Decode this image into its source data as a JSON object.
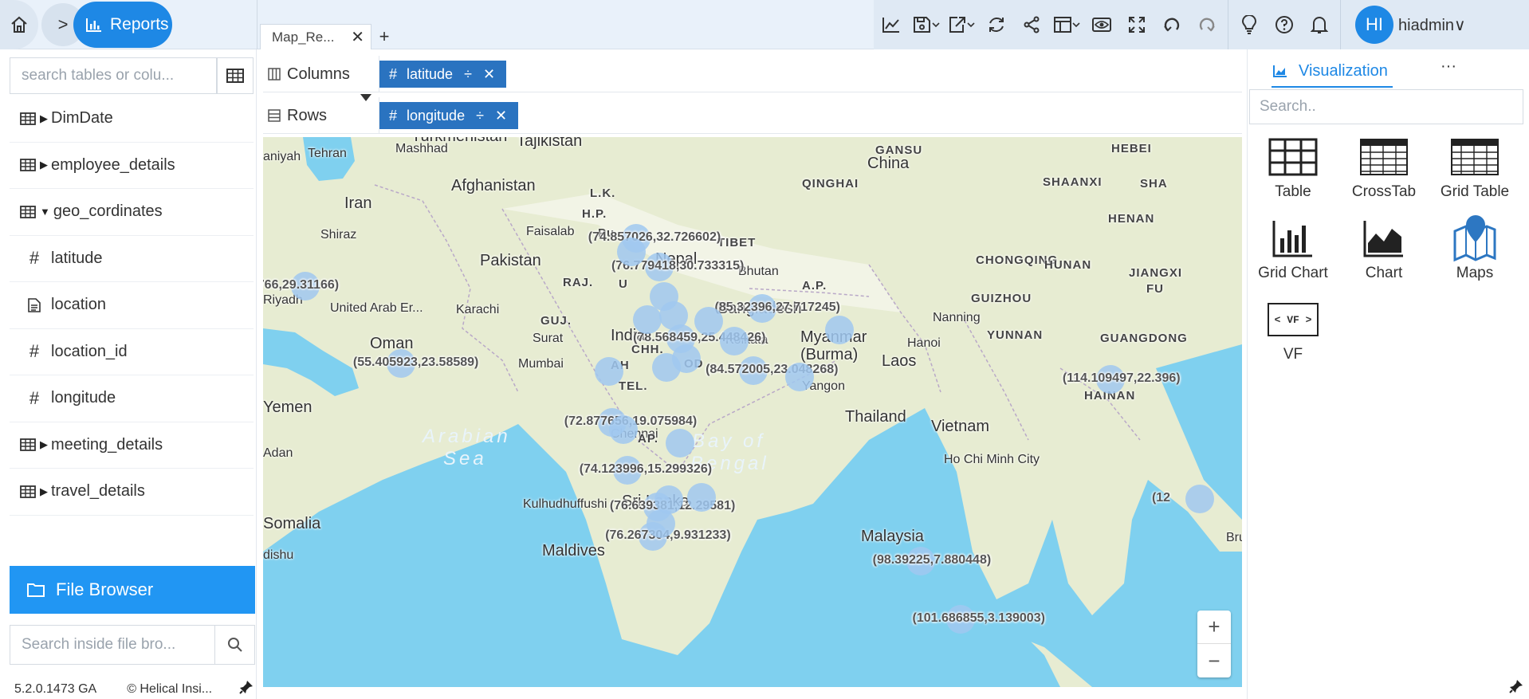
{
  "nav": {
    "app_label": "Reports"
  },
  "tabs": [
    {
      "label": "Map_Re...",
      "close": "✕"
    }
  ],
  "tab_add": "+",
  "user": {
    "initials": "HI",
    "name": "hiadmin"
  },
  "left_panel": {
    "search_placeholder": "search tables or colu...",
    "tree": [
      {
        "label": "DimDate",
        "type": "table",
        "expanded": false
      },
      {
        "label": "employee_details",
        "type": "table",
        "expanded": false
      },
      {
        "label": "geo_cordinates",
        "type": "table",
        "expanded": true
      },
      {
        "label": "latitude",
        "type": "numeric",
        "child": true
      },
      {
        "label": "location",
        "type": "text",
        "child": true
      },
      {
        "label": "location_id",
        "type": "numeric",
        "child": true
      },
      {
        "label": "longitude",
        "type": "numeric",
        "child": true
      },
      {
        "label": "meeting_details",
        "type": "table",
        "expanded": false
      },
      {
        "label": "travel_details",
        "type": "table",
        "expanded": false
      }
    ],
    "file_browser_label": "File Browser",
    "file_search_placeholder": "Search inside file bro...",
    "version": "5.2.0.1473 GA",
    "copyright": "© Helical Insi..."
  },
  "shelves": {
    "columns": {
      "label": "Columns",
      "field": "latitude"
    },
    "rows": {
      "label": "Rows",
      "field": "longitude"
    },
    "field_prefix": "#",
    "field_split": "÷",
    "field_remove": "✕"
  },
  "map": {
    "places": [
      "Tajikistan",
      "Turkmenistan",
      "Mashhad",
      "Tehran",
      "aniyah",
      "Afghanistan",
      "Iran",
      "Shiraz",
      "Pakistan",
      "Faisalab",
      "Karachi",
      "Riyadh",
      "United Arab Er...",
      "Oman",
      "Yemen",
      "Adan",
      "Somalia",
      "dishu",
      "Surat",
      "Mumbai",
      "India",
      "Chennai",
      "Kolkata",
      "Bangladesh",
      "Bhutan",
      "Nepal",
      "China",
      "Myanmar",
      "(Burma)",
      "Laos",
      "Thailand",
      "Vietnam",
      "Yangon",
      "Hanoi",
      "Nanning",
      "Ho Chi Minh City",
      "Malaysia",
      "Sri Lanka",
      "Maldives",
      "Kulhudhuffushi",
      "Bru"
    ],
    "regions": [
      "GANSU",
      "HEBEI",
      "QINGHAI",
      "SHAANXI",
      "SHA",
      "HENAN",
      "TIBET",
      "CHONGQING",
      "HUNAN",
      "JIANGXI",
      "GUIZHOU",
      "FU",
      "YUNNAN",
      "GUANGDONG",
      "HAINAN",
      "A.P.",
      "H.P.",
      "L.K.",
      "RAJ.",
      "GUJ.",
      "CHH.",
      "OD",
      "TEL.",
      "U",
      "AP.",
      "AH",
      "Pu",
      "Mumbai"
    ],
    "seas": [
      "Arabian",
      "Sea",
      "Bay of",
      "Bengal"
    ],
    "points": [
      {
        "label": "(74.857026,32.726602)",
        "lon": 74.857026,
        "lat": 32.726602
      },
      {
        "label": "(76.779418,30.733315)",
        "lon": 76.779418,
        "lat": 30.733315
      },
      {
        "label": "(85.32396,27.717245)",
        "lon": 85.32396,
        "lat": 27.717245
      },
      {
        "label": "(78.568459,25.448426)",
        "lon": 78.568459,
        "lat": 25.448426
      },
      {
        "label": "(84.572005,23.048268)",
        "lon": 84.572005,
        "lat": 23.048268
      },
      {
        "label": "(55.405923,23.58589)",
        "lon": 55.405923,
        "lat": 23.58589
      },
      {
        "label": "(72.877656,19.075984)",
        "lon": 72.877656,
        "lat": 19.075984
      },
      {
        "label": "(74.123996,15.299326)",
        "lon": 74.123996,
        "lat": 15.299326
      },
      {
        "label": "(76.639381,12.29581)",
        "lon": 76.639381,
        "lat": 12.29581
      },
      {
        "label": "(76.267304,9.931233)",
        "lon": 76.267304,
        "lat": 9.931233
      },
      {
        "label": "(114.109497,22.396)",
        "lon": 114.109497,
        "lat": 22.396
      },
      {
        "label": "(98.39225,7.880448)",
        "lon": 98.39225,
        "lat": 7.880448
      },
      {
        "label": "(101.686855,3.139003)",
        "lon": 101.686855,
        "lat": 3.139003
      },
      {
        "label": "766,29.31166)",
        "lon": 47.48,
        "lat": 29.31166
      },
      {
        "label": "(12",
        "lon": 121.5,
        "lat": 13.0
      }
    ],
    "zoom_in": "+",
    "zoom_out": "−"
  },
  "right_panel": {
    "tab_label": "Visualization",
    "more": "···",
    "search_placeholder": "Search..",
    "items": [
      {
        "label": "Table",
        "icon": "table-icon"
      },
      {
        "label": "CrossTab",
        "icon": "crosstab-icon"
      },
      {
        "label": "Grid Table",
        "icon": "grid-table-icon"
      },
      {
        "label": "Grid Chart",
        "icon": "grid-chart-icon"
      },
      {
        "label": "Chart",
        "icon": "area-chart-icon"
      },
      {
        "label": "Maps",
        "icon": "maps-icon"
      },
      {
        "label": "VF",
        "icon": "vf-icon",
        "icon_text": "< VF >"
      }
    ]
  },
  "colors": {
    "accent": "#1e88e5",
    "pill": "#2a73c0",
    "water": "#7fd0ef",
    "land": "#e7ecd2",
    "bubble": "#a0c8f0"
  }
}
